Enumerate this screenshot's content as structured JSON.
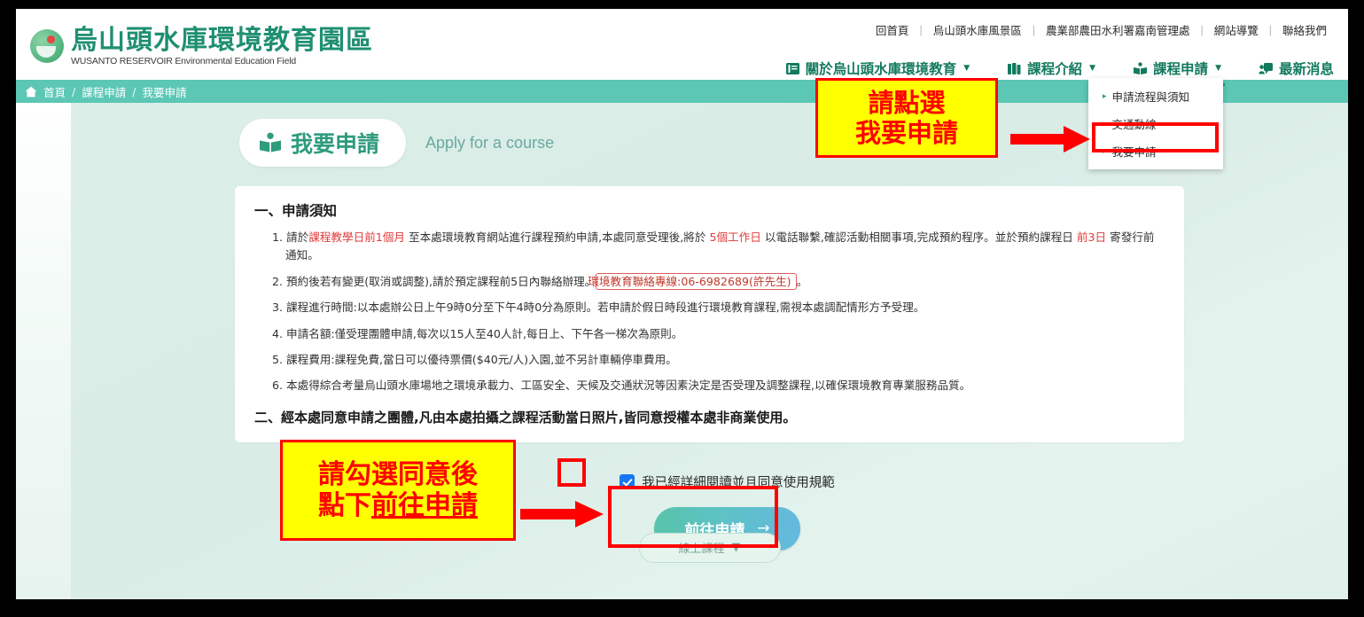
{
  "site": {
    "logo_cn": "烏山頭水庫環境教育園區",
    "logo_en": "WUSANTO RESERVOIR Environmental Education Field"
  },
  "utility_links": [
    {
      "label": "回首頁"
    },
    {
      "label": "烏山頭水庫風景區"
    },
    {
      "label": "農業部農田水利署嘉南管理處"
    },
    {
      "label": "網站導覽"
    },
    {
      "label": "聯絡我們"
    }
  ],
  "util_separator": "|",
  "mainnav": [
    {
      "label": "關於烏山頭水庫環境教育",
      "icon": "book-list-icon",
      "caret": "▼",
      "active": false
    },
    {
      "label": "課程介紹",
      "icon": "books-icon",
      "caret": "▼",
      "active": false
    },
    {
      "label": "課程申請",
      "icon": "open-book-icon",
      "caret": "▼",
      "active": true
    },
    {
      "label": "最新消息",
      "icon": "news-person-icon",
      "caret": "",
      "active": false
    }
  ],
  "dropdown": {
    "items": [
      {
        "label": "申請流程與須知",
        "marker": "▸"
      },
      {
        "label": "交通動線",
        "marker": "▸"
      },
      {
        "label": "我要申請",
        "marker": "▸"
      }
    ]
  },
  "breadcrumb": {
    "home_icon": "home-icon",
    "items": [
      "首頁",
      "課程申請",
      "我要申請"
    ],
    "separator": "/"
  },
  "page_title": {
    "icon": "open-book-icon",
    "cn": "我要申請",
    "en": "Apply for a course"
  },
  "notice": {
    "section1_heading": "一、申請須知",
    "items": [
      {
        "num": "1.",
        "parts": [
          {
            "t": "請於",
            "hl": false
          },
          {
            "t": "課程教學日前1個月",
            "hl": true
          },
          {
            "t": " 至本處環境教育網站進行課程預約申請,本處同意受理後,將於 ",
            "hl": false
          },
          {
            "t": "5個工作日",
            "hl": true
          },
          {
            "t": " 以電話聯繫,確認活動相關事項,完成預約程序。並於預約課程日 ",
            "hl": false
          },
          {
            "t": "前3日",
            "hl": true
          },
          {
            "t": " 寄發行前通知。",
            "hl": false
          }
        ]
      },
      {
        "num": "2.",
        "parts": [
          {
            "t": "預約後若有變更(取消或調整),請於預定課程前5日內聯絡辦理。",
            "hl": false
          },
          {
            "t": "環境教育聯絡專線:06-6982689(許先生)",
            "box": true
          },
          {
            "t": "。",
            "hl": false
          }
        ]
      },
      {
        "num": "3.",
        "parts": [
          {
            "t": "課程進行時間:以本處辦公日上午9時0分至下午4時0分為原則。若申請於假日時段進行環境教育課程,需視本處調配情形方予受理。",
            "hl": false
          }
        ]
      },
      {
        "num": "4.",
        "parts": [
          {
            "t": "申請名額:僅受理團體申請,每次以15人至40人計,每日上、下午各一梯次為原則。",
            "hl": false
          }
        ]
      },
      {
        "num": "5.",
        "parts": [
          {
            "t": "課程費用:課程免費,當日可以優待票價($40元/人)入園,並不另計車輛停車費用。",
            "hl": false
          }
        ]
      },
      {
        "num": "6.",
        "parts": [
          {
            "t": "本處得綜合考量烏山頭水庫場地之環境承載力、工區安全、天候及交通狀況等因素決定是否受理及調整課程,以確保環境教育專業服務品質。",
            "hl": false
          }
        ]
      }
    ],
    "section2_heading": "二、經本處同意申請之團體,凡由本處拍攝之課程活動當日照片,皆同意授權本處非商業使用。"
  },
  "agree": {
    "checked": true,
    "label": "我已經詳細閱讀並且同意使用規範"
  },
  "submit": {
    "label": "前往申請",
    "arrow": "→"
  },
  "bottom_pill": {
    "label": "線上課程",
    "caret": "▼"
  },
  "annotations": {
    "top": {
      "line1": "請點選",
      "line2": "我要申請"
    },
    "left": {
      "line1": "請勾選同意後",
      "line2_pre": "點下",
      "line2_underline": "前往申請"
    }
  },
  "colors": {
    "brand_green": "#127a5e",
    "teal_bar": "#5cc7b5",
    "annotation_bg": "#ffff00",
    "annotation_fg": "#ff0000",
    "checkbox_blue": "#1877f2"
  }
}
